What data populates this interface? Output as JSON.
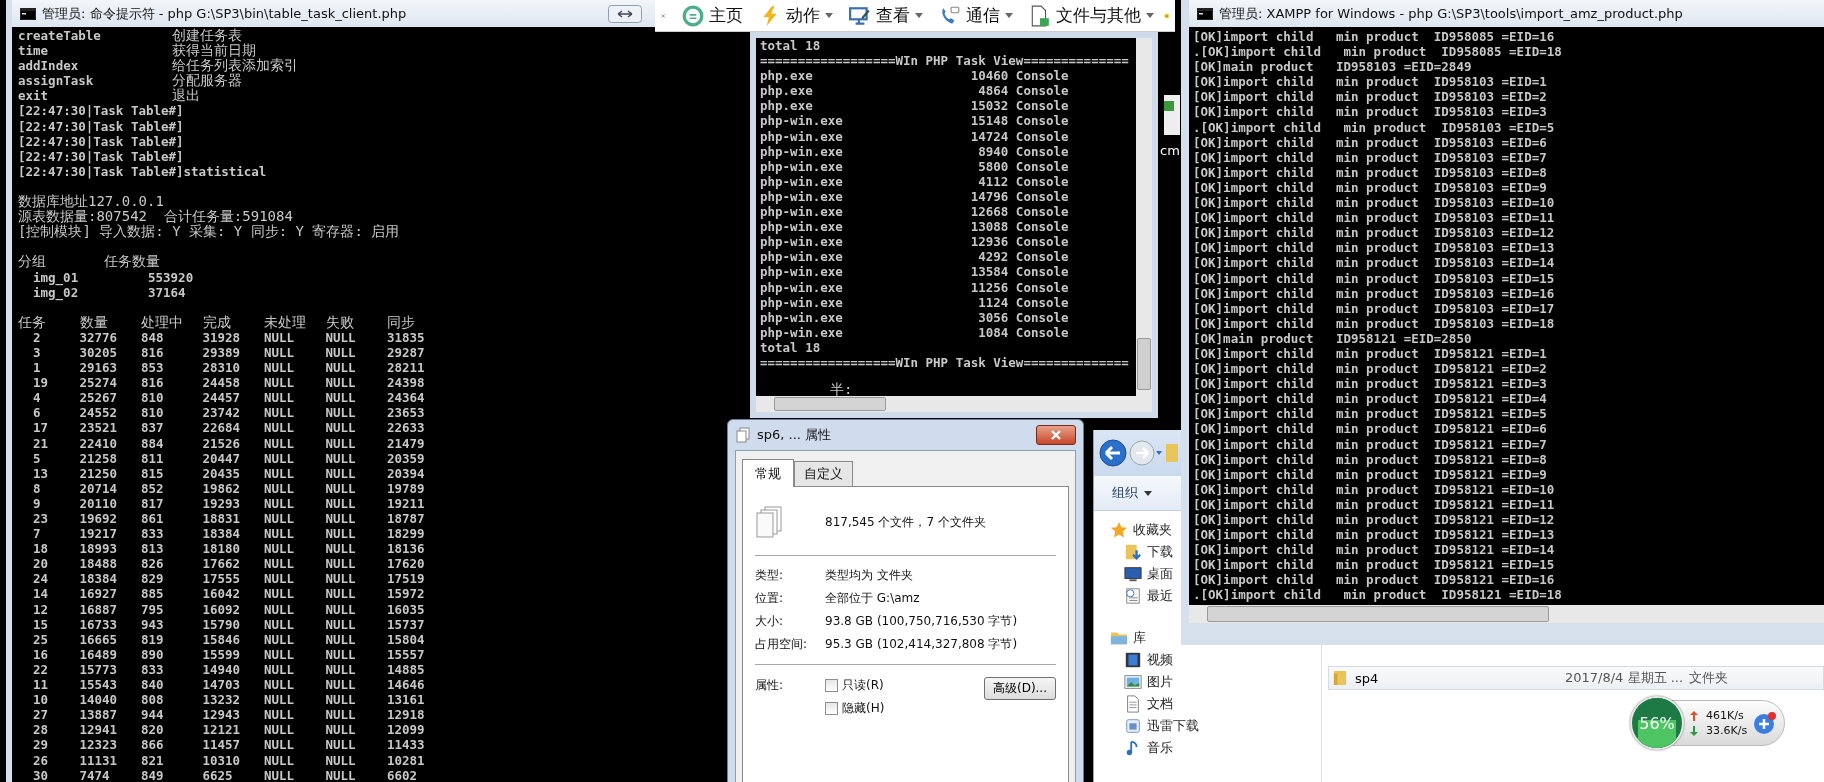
{
  "left_console": {
    "title": "管理员: 命令提示符 - php  G:\\SP3\\bin\\table_task_client.php",
    "commands": [
      {
        "command": "createTable",
        "description": "创建任务表"
      },
      {
        "command": "time",
        "description": "获得当前日期"
      },
      {
        "command": "addIndex",
        "description": "给任务列表添加索引"
      },
      {
        "command": "assignTask",
        "description": "分配服务器"
      },
      {
        "command": "exit",
        "description": "退出"
      }
    ],
    "prompts": [
      "[22:47:30|Task Table#]",
      "[22:47:30|Task Table#]",
      "[22:47:30|Task Table#]",
      "[22:47:30|Task Table#]",
      "[22:47:30|Task Table#]statistical"
    ],
    "info_lines": [
      "数据库地址127.0.0.1",
      "源表数据量:807542  合计任务量:591084",
      "[控制模块] 导入数据: Y 采集: Y 同步: Y 寄存器: 启用"
    ],
    "group_table": {
      "columns": [
        "分组",
        "任务数量"
      ],
      "rows": [
        [
          "img_01",
          "553920"
        ],
        [
          "img_02",
          "37164"
        ]
      ]
    },
    "task_table": {
      "columns": [
        "任务",
        "数量",
        "处理中",
        "完成",
        "未处理",
        "失败",
        "同步"
      ],
      "rows": [
        [
          "2",
          "32776",
          "848",
          "31928",
          "NULL",
          "NULL",
          "31835"
        ],
        [
          "3",
          "30205",
          "816",
          "29389",
          "NULL",
          "NULL",
          "29287"
        ],
        [
          "1",
          "29163",
          "853",
          "28310",
          "NULL",
          "NULL",
          "28211"
        ],
        [
          "19",
          "25274",
          "816",
          "24458",
          "NULL",
          "NULL",
          "24398"
        ],
        [
          "4",
          "25267",
          "810",
          "24457",
          "NULL",
          "NULL",
          "24364"
        ],
        [
          "6",
          "24552",
          "810",
          "23742",
          "NULL",
          "NULL",
          "23653"
        ],
        [
          "17",
          "23521",
          "837",
          "22684",
          "NULL",
          "NULL",
          "22633"
        ],
        [
          "21",
          "22410",
          "884",
          "21526",
          "NULL",
          "NULL",
          "21479"
        ],
        [
          "5",
          "21258",
          "811",
          "20447",
          "NULL",
          "NULL",
          "20359"
        ],
        [
          "13",
          "21250",
          "815",
          "20435",
          "NULL",
          "NULL",
          "20394"
        ],
        [
          "8",
          "20714",
          "852",
          "19862",
          "NULL",
          "NULL",
          "19789"
        ],
        [
          "9",
          "20110",
          "817",
          "19293",
          "NULL",
          "NULL",
          "19211"
        ],
        [
          "23",
          "19692",
          "861",
          "18831",
          "NULL",
          "NULL",
          "18787"
        ],
        [
          "7",
          "19217",
          "833",
          "18384",
          "NULL",
          "NULL",
          "18299"
        ],
        [
          "18",
          "18993",
          "813",
          "18180",
          "NULL",
          "NULL",
          "18136"
        ],
        [
          "20",
          "18488",
          "826",
          "17662",
          "NULL",
          "NULL",
          "17620"
        ],
        [
          "24",
          "18384",
          "829",
          "17555",
          "NULL",
          "NULL",
          "17519"
        ],
        [
          "14",
          "16927",
          "885",
          "16042",
          "NULL",
          "NULL",
          "15972"
        ],
        [
          "12",
          "16887",
          "795",
          "16092",
          "NULL",
          "NULL",
          "16035"
        ],
        [
          "15",
          "16733",
          "943",
          "15790",
          "NULL",
          "NULL",
          "15737"
        ],
        [
          "25",
          "16665",
          "819",
          "15846",
          "NULL",
          "NULL",
          "15804"
        ],
        [
          "16",
          "16489",
          "890",
          "15599",
          "NULL",
          "NULL",
          "15557"
        ],
        [
          "22",
          "15773",
          "833",
          "14940",
          "NULL",
          "NULL",
          "14885"
        ],
        [
          "11",
          "15543",
          "840",
          "14703",
          "NULL",
          "NULL",
          "14646"
        ],
        [
          "10",
          "14040",
          "808",
          "13232",
          "NULL",
          "NULL",
          "13161"
        ],
        [
          "27",
          "13887",
          "944",
          "12943",
          "NULL",
          "NULL",
          "12918"
        ],
        [
          "28",
          "12941",
          "820",
          "12121",
          "NULL",
          "NULL",
          "12099"
        ],
        [
          "29",
          "12323",
          "866",
          "11457",
          "NULL",
          "NULL",
          "11433"
        ],
        [
          "26",
          "11131",
          "821",
          "10310",
          "NULL",
          "NULL",
          "10281"
        ],
        [
          "30",
          "7474",
          "849",
          "6625",
          "NULL",
          "NULL",
          "6602"
        ]
      ]
    }
  },
  "toolbar": {
    "items": [
      {
        "label": "主页",
        "kind": "home"
      },
      {
        "label": "动作",
        "kind": "action"
      },
      {
        "label": "查看",
        "kind": "view"
      },
      {
        "label": "通信",
        "kind": "comm"
      },
      {
        "label": "文件与其他",
        "kind": "files"
      }
    ]
  },
  "middle_console": {
    "header_lines": [
      "total 18",
      "==================WIn PHP Task View=============="
    ],
    "processes": [
      {
        "name": "php.exe",
        "pid": "10460",
        "session": "Console"
      },
      {
        "name": "php.exe",
        "pid": "4864",
        "session": "Console"
      },
      {
        "name": "php.exe",
        "pid": "15032",
        "session": "Console"
      },
      {
        "name": "php-win.exe",
        "pid": "15148",
        "session": "Console"
      },
      {
        "name": "php-win.exe",
        "pid": "14724",
        "session": "Console"
      },
      {
        "name": "php-win.exe",
        "pid": "8940",
        "session": "Console"
      },
      {
        "name": "php-win.exe",
        "pid": "5800",
        "session": "Console"
      },
      {
        "name": "php-win.exe",
        "pid": "4112",
        "session": "Console"
      },
      {
        "name": "php-win.exe",
        "pid": "14796",
        "session": "Console"
      },
      {
        "name": "php-win.exe",
        "pid": "12668",
        "session": "Console"
      },
      {
        "name": "php-win.exe",
        "pid": "13088",
        "session": "Console"
      },
      {
        "name": "php-win.exe",
        "pid": "12936",
        "session": "Console"
      },
      {
        "name": "php-win.exe",
        "pid": "4292",
        "session": "Console"
      },
      {
        "name": "php-win.exe",
        "pid": "13584",
        "session": "Console"
      },
      {
        "name": "php-win.exe",
        "pid": "11256",
        "session": "Console"
      },
      {
        "name": "php-win.exe",
        "pid": "1124",
        "session": "Console"
      },
      {
        "name": "php-win.exe",
        "pid": "3056",
        "session": "Console"
      },
      {
        "name": "php-win.exe",
        "pid": "1084",
        "session": "Console"
      }
    ],
    "footer_lines": [
      "total 18",
      "==================WIn PHP Task View=============="
    ],
    "prompt": "半:"
  },
  "desktop_icon": {
    "label": "cm"
  },
  "properties_dialog": {
    "title": "sp6, ... 属性",
    "tabs": [
      {
        "label": "常规",
        "selected": true
      },
      {
        "label": "自定义",
        "selected": false
      }
    ],
    "summary": "817,545 个文件，7 个文件夹",
    "fields": [
      {
        "label": "类型:",
        "value": "类型均为 文件夹"
      },
      {
        "label": "位置:",
        "value": "全部位于 G:\\amz"
      },
      {
        "label": "大小:",
        "value": "93.8 GB (100,750,716,530 字节)"
      },
      {
        "label": "占用空间:",
        "value": "95.3 GB (102,414,327,808 字节)"
      }
    ],
    "attributes_label": "属性:",
    "checkboxes": [
      {
        "label": "只读(R)",
        "checked": false
      },
      {
        "label": "隐藏(H)",
        "checked": false
      }
    ],
    "advanced_button": "高级(D)..."
  },
  "explorer": {
    "organize": "组织",
    "sidebar": [
      {
        "label": "收藏夹",
        "kind": "favorites",
        "children": [
          {
            "label": "下载",
            "kind": "download"
          },
          {
            "label": "桌面",
            "kind": "desktop"
          },
          {
            "label": "最近",
            "kind": "recent"
          }
        ]
      },
      {
        "label": "库",
        "kind": "library",
        "children": [
          {
            "label": "视频",
            "kind": "video"
          },
          {
            "label": "图片",
            "kind": "pictures"
          },
          {
            "label": "文档",
            "kind": "documents"
          },
          {
            "label": "迅雷下载",
            "kind": "xunlei"
          },
          {
            "label": "音乐",
            "kind": "music"
          }
        ]
      }
    ],
    "files": [
      {
        "name": "sp4",
        "modified": "2017/8/4 星期五 ...",
        "type": "文件夹"
      }
    ]
  },
  "right_console": {
    "title": "管理员: XAMPP for Windows - php  G:\\SP3\\tools\\import_amz_product.php",
    "lines": [
      "[OK]import child   min product  ID958085 =EID=16",
      ".[OK]import child   min product  ID958085 =EID=18",
      "[OK]main product   ID958103 =EID=2849",
      "[OK]import child   min product  ID958103 =EID=1",
      "[OK]import child   min product  ID958103 =EID=2",
      "[OK]import child   min product  ID958103 =EID=3",
      ".[OK]import child   min product  ID958103 =EID=5",
      "[OK]import child   min product  ID958103 =EID=6",
      "[OK]import child   min product  ID958103 =EID=7",
      "[OK]import child   min product  ID958103 =EID=8",
      "[OK]import child   min product  ID958103 =EID=9",
      "[OK]import child   min product  ID958103 =EID=10",
      "[OK]import child   min product  ID958103 =EID=11",
      "[OK]import child   min product  ID958103 =EID=12",
      "[OK]import child   min product  ID958103 =EID=13",
      "[OK]import child   min product  ID958103 =EID=14",
      "[OK]import child   min product  ID958103 =EID=15",
      "[OK]import child   min product  ID958103 =EID=16",
      "[OK]import child   min product  ID958103 =EID=17",
      "[OK]import child   min product  ID958103 =EID=18",
      "[OK]main product   ID958121 =EID=2850",
      "[OK]import child   min product  ID958121 =EID=1",
      "[OK]import child   min product  ID958121 =EID=2",
      "[OK]import child   min product  ID958121 =EID=3",
      "[OK]import child   min product  ID958121 =EID=4",
      "[OK]import child   min product  ID958121 =EID=5",
      "[OK]import child   min product  ID958121 =EID=6",
      "[OK]import child   min product  ID958121 =EID=7",
      "[OK]import child   min product  ID958121 =EID=8",
      "[OK]import child   min product  ID958121 =EID=9",
      "[OK]import child   min product  ID958121 =EID=10",
      "[OK]import child   min product  ID958121 =EID=11",
      "[OK]import child   min product  ID958121 =EID=12",
      "[OK]import child   min product  ID958121 =EID=13",
      "[OK]import child   min product  ID958121 =EID=14",
      "[OK]import child   min product  ID958121 =EID=15",
      "[OK]import child   min product  ID958121 =EID=16",
      ".[OK]import child   min product  ID958121 =EID=18"
    ]
  },
  "net_widget": {
    "memory_label": "56%",
    "level": 0.56,
    "upload": "461K/s",
    "download": "33.6K/s"
  }
}
